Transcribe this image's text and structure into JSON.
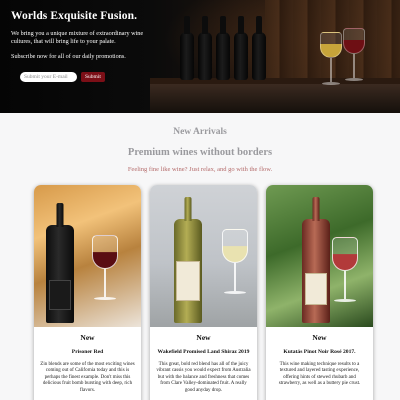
{
  "hero": {
    "title": "Worlds Exquisite Fusion.",
    "description": "We bring you a unique mixture of extraordinary wine cultures, that will bring life to your palate.",
    "subscribe_text": "Subscribe now for all of our daily promotions.",
    "email_placeholder": "Submit your E-mail",
    "submit_label": "Submit"
  },
  "section": {
    "heading": "New Arrivals",
    "subheading": "Premium wines without borders",
    "tagline": "Feeling fine like wine? Just relax, and go with the flow."
  },
  "products": [
    {
      "badge": "New",
      "name": "Prisoner Red",
      "description": "Zin blends are some of the most exciting wines coming out of California today and this is perhaps the finest example. Don't miss this delicious fruit bomb bursting with deep, rich flavors."
    },
    {
      "badge": "New",
      "name": "Wakefield Promised Land Shiraz 2019",
      "description": "This great, bold red blend has all of the juicy vibrant cassis you would expect from Australia but with the balance and freshness that comes from Clare Valley-dominated fruit. A really good anyday drop."
    },
    {
      "badge": "New",
      "name": "Kutatás Pinot Noir Rosé 2017.",
      "description": "This wine making technique results to a textured and layered tasting experience, offering hints of stewed rhubarb and strawberry, as well as a buttery pie crust."
    }
  ],
  "colors": {
    "accent": "#7c0f17",
    "heading_gray": "#9a9a9e",
    "tagline": "#b46a6a",
    "page_bg": "#f7f7f8"
  }
}
